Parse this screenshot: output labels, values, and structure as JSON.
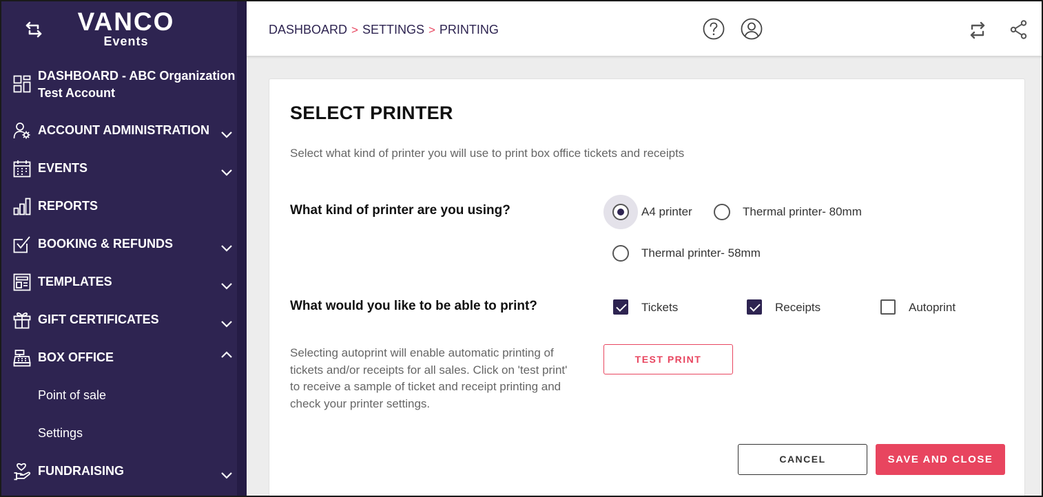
{
  "app": {
    "logo_main": "VANCO",
    "logo_sub": "Events"
  },
  "sidebar": {
    "items": [
      {
        "label": "DASHBOARD - ABC Organization",
        "label2": "Test Account",
        "icon": "dashboard-grid-icon"
      },
      {
        "label": "ACCOUNT ADMINISTRATION",
        "icon": "user-gear-icon",
        "expanded": false
      },
      {
        "label": "EVENTS",
        "icon": "calendar-icon",
        "expanded": false
      },
      {
        "label": "REPORTS",
        "icon": "bar-chart-icon"
      },
      {
        "label": "BOOKING & REFUNDS",
        "icon": "checkbox-icon",
        "expanded": false
      },
      {
        "label": "TEMPLATES",
        "icon": "template-icon",
        "expanded": false
      },
      {
        "label": "GIFT CERTIFICATES",
        "icon": "gift-icon",
        "expanded": false
      },
      {
        "label": "BOX OFFICE",
        "icon": "cash-register-icon",
        "expanded": true
      },
      {
        "label": "Point of sale"
      },
      {
        "label": "Settings"
      },
      {
        "label": "FUNDRAISING",
        "icon": "heart-hand-icon",
        "expanded": false
      }
    ]
  },
  "header": {
    "breadcrumb": [
      "DASHBOARD",
      "SETTINGS",
      "PRINTING"
    ],
    "separator": ">",
    "icons": [
      "help-icon",
      "user-account-icon",
      "switch-icon",
      "share-icon"
    ]
  },
  "card": {
    "title": "SELECT PRINTER",
    "description": "Select what kind of printer you will use to print box office tickets and receipts",
    "printer_question": "What kind of printer are you using?",
    "printer_options": [
      {
        "label": "A4 printer",
        "selected": true
      },
      {
        "label": "Thermal printer- 80mm",
        "selected": false
      },
      {
        "label": "Thermal printer- 58mm",
        "selected": false
      }
    ],
    "print_question": "What would you like to be able to print?",
    "print_options": [
      {
        "label": "Tickets",
        "checked": true
      },
      {
        "label": "Receipts",
        "checked": true
      },
      {
        "label": "Autoprint",
        "checked": false
      }
    ],
    "note": "Selecting autoprint will enable automatic printing of tickets and/or receipts for all sales. Click on 'test print' to receive a sample of ticket and receipt printing and check your printer settings.",
    "test_print_label": "TEST PRINT",
    "cancel_label": "CANCEL",
    "save_label": "SAVE AND CLOSE"
  },
  "colors": {
    "sidebar_bg": "#2e2451",
    "accent": "#e8455f",
    "selected": "#2e2451"
  }
}
